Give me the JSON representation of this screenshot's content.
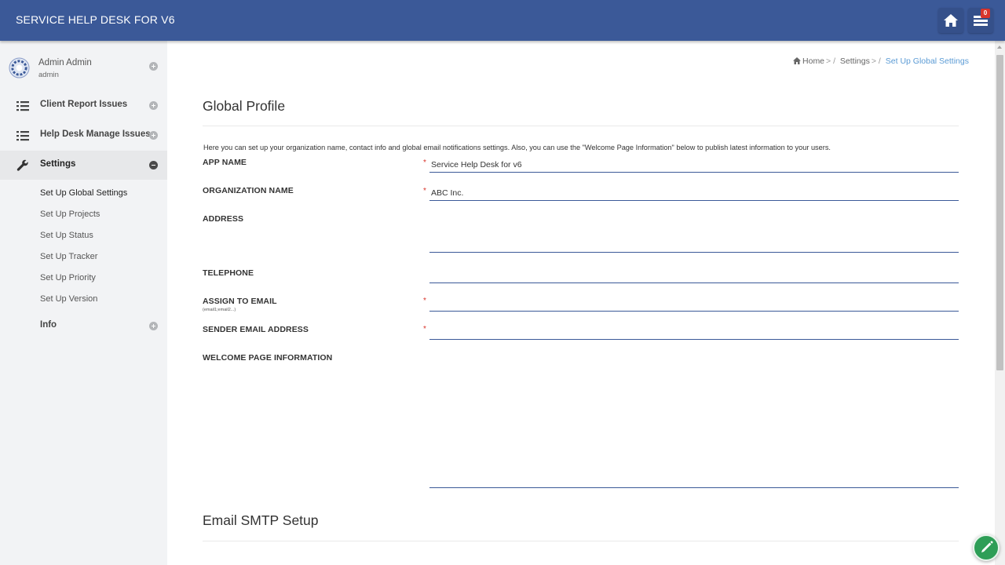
{
  "header": {
    "app_title": "SERVICE HELP DESK FOR V6",
    "home_icon": "home-icon",
    "tasks_icon": "tasks-icon",
    "notification_count": "0",
    "color": "#3b5998"
  },
  "sidebar": {
    "user": {
      "name": "Admin Admin",
      "role": "admin"
    },
    "items": [
      {
        "label": "Client Report Issues",
        "icon": "list-icon"
      },
      {
        "label": "Help Desk Manage Issues",
        "icon": "list-icon"
      },
      {
        "label": "Settings",
        "icon": "wrench-icon"
      },
      {
        "label": "Info",
        "icon": ""
      }
    ],
    "settings_sub": [
      "Set Up Global Settings",
      "Set Up Projects",
      "Set Up Status",
      "Set Up Tracker",
      "Set Up Priority",
      "Set Up Version"
    ]
  },
  "breadcrumb": {
    "home": "Home",
    "settings": "Settings",
    "current": "Set Up Global Settings"
  },
  "global_profile": {
    "title": "Global Profile",
    "intro": "Here you can set up your organization name, contact info and global email notifications settings. Also, you can use the \"Welcome Page Information\" below to publish latest information to your users.",
    "fields": {
      "app_name": {
        "label": "APP NAME",
        "value": "Service Help Desk for v6",
        "required": "*"
      },
      "organization_name": {
        "label": "ORGANIZATION NAME",
        "value": "ABC Inc.",
        "required": "*"
      },
      "address": {
        "label": "ADDRESS",
        "value": ""
      },
      "telephone": {
        "label": "TELEPHONE",
        "value": ""
      },
      "assign_to_email": {
        "label": "ASSIGN TO EMAIL",
        "hint": "(email1;email2...)",
        "value": "",
        "required": "*"
      },
      "sender_email": {
        "label": "SENDER EMAIL ADDRESS",
        "value": "",
        "required": "*"
      },
      "welcome_info": {
        "label": "WELCOME PAGE INFORMATION",
        "value": ""
      }
    }
  },
  "smtp": {
    "title": "Email SMTP Setup"
  },
  "fab": {
    "icon": "pencil-icon",
    "color": "#2e9e57"
  }
}
